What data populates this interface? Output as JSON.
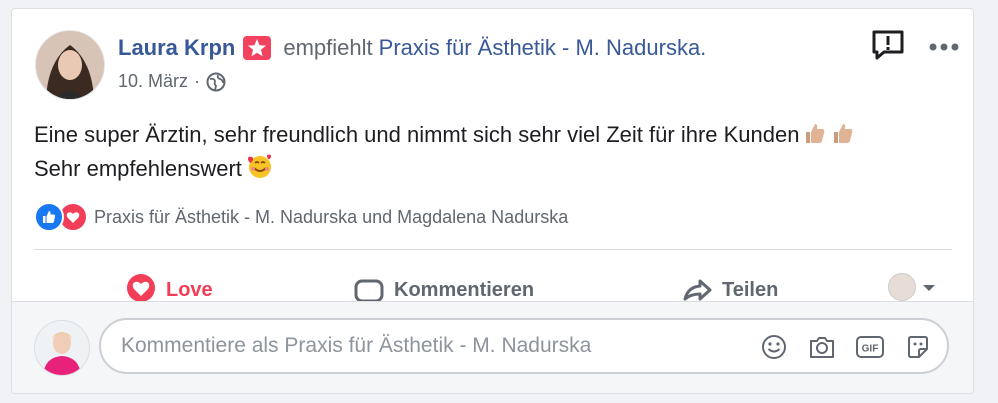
{
  "post": {
    "author_name": "Laura Krpn",
    "recommend_text": "empfiehlt",
    "page_name": "Praxis für Ästhetik - M. Nadurska.",
    "date": "10. März",
    "separator": "·",
    "audience_icon": "globe-icon",
    "body_line1": "Eine super Ärztin, sehr freundlich und nimmt sich sehr viel Zeit für ihre Kunden",
    "body_line2": "Sehr empfehlenswert",
    "emojis": [
      "thumbs-up-emoji",
      "thumbs-up-emoji",
      "smiling-face-with-hearts-emoji"
    ]
  },
  "reactions": {
    "icons": [
      "like-reaction-icon",
      "love-reaction-icon"
    ],
    "text": "Praxis für Ästhetik - M. Nadurska und Magdalena Nadurska"
  },
  "actions": {
    "love_label": "Love",
    "comment_label": "Kommentieren",
    "share_label": "Teilen"
  },
  "comment_box": {
    "placeholder": "Kommentiere als Praxis für Ästhetik - M. Nadurska",
    "tools": [
      "emoji-icon",
      "camera-icon",
      "gif-icon",
      "sticker-icon"
    ]
  },
  "colors": {
    "link_blue": "#385898",
    "love_red": "#f33e58",
    "like_blue": "#1877f2",
    "badge_pink": "#f3425f",
    "muted_text": "#606770"
  }
}
